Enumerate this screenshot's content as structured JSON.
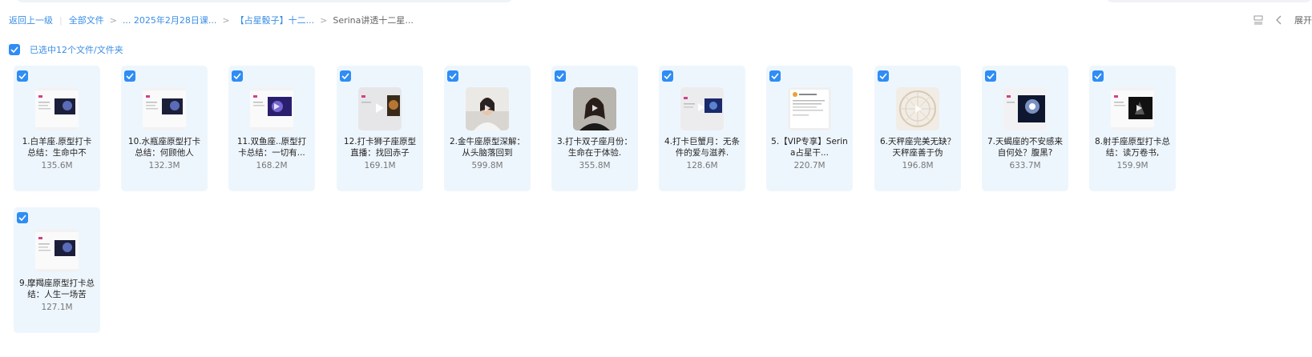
{
  "breadcrumb": {
    "back_label": "返回上一级",
    "all_files_label": "全部文件",
    "items": [
      {
        "label": "... 2025年2月28日课..."
      },
      {
        "label": "【占星骰子】十二..."
      }
    ],
    "current": "Serina讲透十二星..."
  },
  "toolbar": {
    "expand_label": "展开"
  },
  "selection": {
    "label": "已选中12个文件/文件夹"
  },
  "files": [
    {
      "name": "1.白羊座.原型打卡总结：生命中不",
      "size": "135.6M",
      "thumb": "slide-dark"
    },
    {
      "name": "10.水瓶座原型打卡总结：何顾他人",
      "size": "132.3M",
      "thumb": "slide-dark"
    },
    {
      "name": "11.双鱼座..原型打卡总结：一切有...",
      "size": "168.2M",
      "thumb": "slide-purple"
    },
    {
      "name": "12.打卡狮子座原型直播：找回赤子",
      "size": "169.1M",
      "thumb": "slide-warm"
    },
    {
      "name": "2.金牛座原型深解：从头脑落回到",
      "size": "599.8M",
      "thumb": "person"
    },
    {
      "name": "3.打卡双子座月份：生命在于体验.",
      "size": "355.8M",
      "thumb": "person-dark"
    },
    {
      "name": "4.打卡巨蟹月：无条件的爱与滋养.",
      "size": "128.6M",
      "thumb": "slide-blue"
    },
    {
      "name": "5.【VIP专享】Serina占星干...",
      "size": "220.7M",
      "thumb": "document"
    },
    {
      "name": "6.天秤座完美无缺？天秤座善于伪",
      "size": "196.8M",
      "thumb": "wheel"
    },
    {
      "name": "7.天蝎座的不安感来自何处？腹黑?",
      "size": "633.7M",
      "thumb": "slide-flash"
    },
    {
      "name": "8.射手座原型打卡总结：读万卷书,",
      "size": "159.9M",
      "thumb": "slide-black"
    },
    {
      "name": "9.摩羯座原型打卡总结：人生一场苦",
      "size": "127.1M",
      "thumb": "slide-dark"
    }
  ]
}
